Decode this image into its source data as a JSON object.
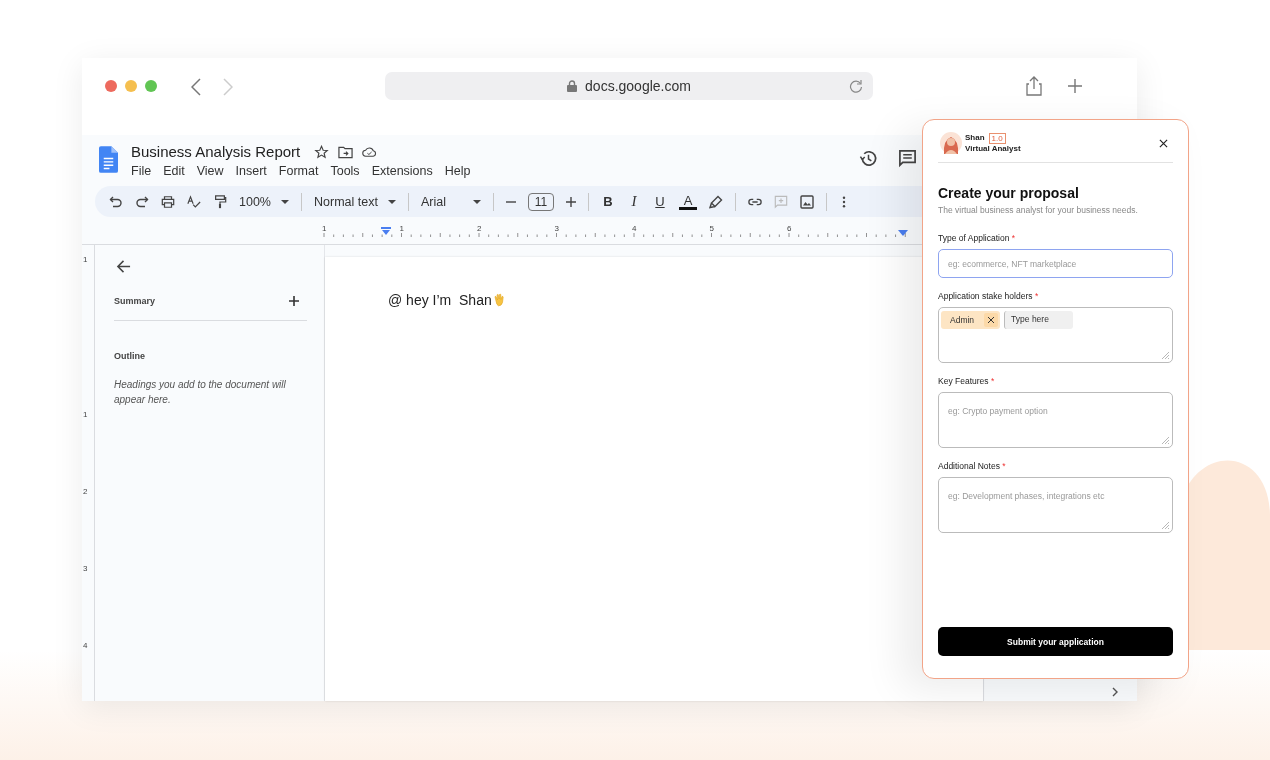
{
  "browser": {
    "url": "docs.google.com"
  },
  "doc": {
    "title": "Business Analysis Report",
    "menu": [
      "File",
      "Edit",
      "View",
      "Insert",
      "Format",
      "Tools",
      "Extensions",
      "Help"
    ],
    "toolbar": {
      "zoom": "100%",
      "style": "Normal text",
      "font": "Arial",
      "font_size": "11",
      "bold": "B",
      "italic": "I",
      "underline": "U",
      "text_color": "A"
    },
    "ruler_labels": [
      "1",
      "1",
      "2",
      "3",
      "4",
      "5",
      "6"
    ],
    "vertical_ruler_labels": [
      "1",
      "1",
      "2",
      "3",
      "4"
    ],
    "outline": {
      "summary": "Summary",
      "heading": "Outline",
      "hint": "Headings you add to the document will appear here."
    },
    "body_text": "@ hey I’m  Shan"
  },
  "panel": {
    "name": "Shan",
    "version": "1.0",
    "role": "Virtual Analyst",
    "title": "Create your proposal",
    "subtitle": "The virtual business analyst for your business needs.",
    "fields": [
      {
        "kind": "input",
        "label": "Type of Application",
        "required_mark": "*",
        "placeholder": "eg: ecommerce, NFT marketplace",
        "focused": true
      },
      {
        "kind": "tags",
        "label": "Application stake holders",
        "required_mark": "*",
        "tags": [
          "Admin"
        ],
        "placeholder": "Type here",
        "focused": false
      },
      {
        "kind": "textarea",
        "label": "Key Features",
        "required_mark": "*",
        "placeholder": "eg: Crypto payment option",
        "focused": false
      },
      {
        "kind": "textarea",
        "label": "Additional Notes",
        "required_mark": "*",
        "placeholder": "eg: Development phases, integrations etc",
        "focused": false
      }
    ],
    "submit": "Submit your application"
  }
}
